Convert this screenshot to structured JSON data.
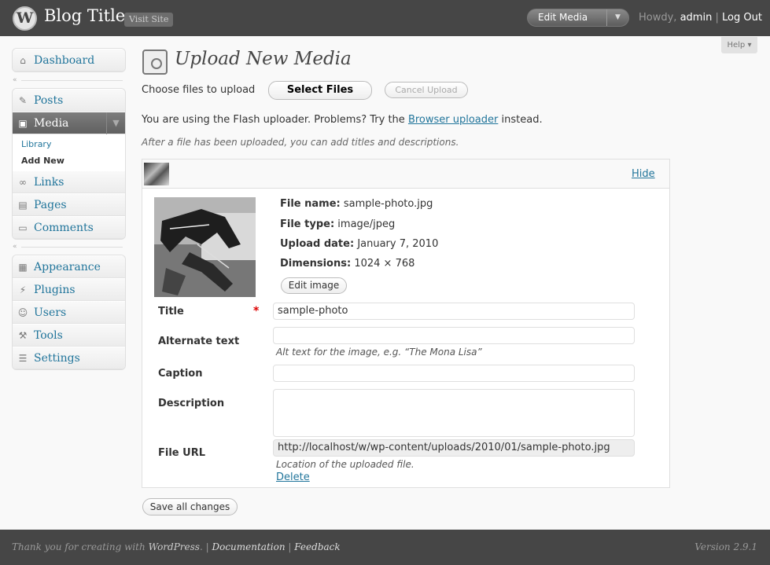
{
  "header": {
    "logo": "W",
    "blog_title": "Blog Title",
    "visit_site": "Visit Site",
    "favorites": "Edit Media",
    "howdy": "Howdy,",
    "user": "admin",
    "logout": "Log Out",
    "help": "Help"
  },
  "menu": {
    "dashboard": "Dashboard",
    "posts": "Posts",
    "media": "Media",
    "library": "Library",
    "add_new": "Add New",
    "links": "Links",
    "pages": "Pages",
    "comments": "Comments",
    "appearance": "Appearance",
    "plugins": "Plugins",
    "users": "Users",
    "tools": "Tools",
    "settings": "Settings"
  },
  "page": {
    "title": "Upload New Media",
    "choose_label": "Choose files to upload",
    "select_files": "Select Files",
    "cancel_upload": "Cancel Upload",
    "flash_pre": "You are using the Flash uploader. Problems? Try the",
    "flash_link": "Browser uploader",
    "flash_post": "instead.",
    "after_note": "After a file has been uploaded, you can add titles and descriptions."
  },
  "item": {
    "hide": "Hide",
    "file_name_label": "File name:",
    "file_name": "sample-photo.jpg",
    "file_type_label": "File type:",
    "file_type": "image/jpeg",
    "upload_date_label": "Upload date:",
    "upload_date": "January 7, 2010",
    "dimensions_label": "Dimensions:",
    "dimensions": "1024 × 768",
    "edit_image": "Edit image",
    "title_label": "Title",
    "required": "*",
    "title_value": "sample-photo",
    "alt_label": "Alternate text",
    "alt_value": "",
    "alt_help": "Alt text for the image, e.g. “The Mona Lisa”",
    "caption_label": "Caption",
    "caption_value": "",
    "description_label": "Description",
    "description_value": "",
    "url_label": "File URL",
    "url_value": "http://localhost/w/wp-content/uploads/2010/01/sample-photo.jpg",
    "url_help": "Location of the uploaded file.",
    "delete": "Delete"
  },
  "save_all": "Save all changes",
  "footer": {
    "thanks": "Thank you for creating with",
    "wordpress": "WordPress",
    "sep": "|",
    "docs": "Documentation",
    "feedback": "Feedback",
    "version": "Version 2.9.1"
  }
}
